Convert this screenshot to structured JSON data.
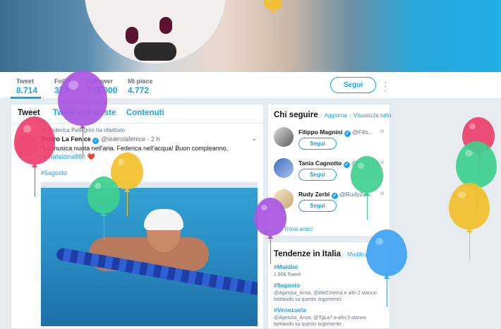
{
  "profile_nav": {
    "stats": [
      {
        "label": "Tweet",
        "value": "8.714",
        "active": true
      },
      {
        "label": "Follower",
        "value": "747.000",
        "active": false
      },
      {
        "label": "Mi piace",
        "value": "4.772",
        "active": false
      }
    ],
    "following_partial": {
      "label": "Follow",
      "value": "373"
    },
    "follow_button": "Segui"
  },
  "timeline": {
    "tabs": [
      "Tweet",
      "Tweet e risposte",
      "Contenuti"
    ],
    "retweet_text": "Federica Pellegrini ha ritwittato",
    "tweet": {
      "author": "Teatro La Fenice",
      "handle": "@teatrolafenice · 2 h",
      "text": "\"La musica nuota nell'aria. Federica nell'acqua! Buon compleanno,",
      "mention": "@mafaldina88!!",
      "emoji": "❤️",
      "hashtag": "#5agosto"
    }
  },
  "who_to_follow": {
    "title": "Chi seguire",
    "refresh": "Aggiorna",
    "view_all": "Visualizza tutto",
    "users": [
      {
        "name": "Filippo Magnini",
        "handle": "@Filo...",
        "button": "Segui"
      },
      {
        "name": "Tania Cagnotto",
        "handle": "@Tani...",
        "button": "Segui"
      },
      {
        "name": "Rudy Zerbi",
        "handle": "@RudyZe...",
        "button": "Segui"
      }
    ],
    "find_friends": "Trova amici"
  },
  "trends": {
    "title": "Tendenze in Italia",
    "edit": "Modifica",
    "items": [
      {
        "name": "#Maldini",
        "meta": "1.906 Tweet"
      },
      {
        "name": "#5agosto",
        "meta": "@Agenzia_Ansa, @WeCinema e altri 2 stanno twittando su questo argomento"
      },
      {
        "name": "#Venezuela",
        "meta": "@Agenzia_Ansa, @TgLa7 e altri 5 stanno twittando su questo argomento"
      }
    ]
  },
  "colors": {
    "accent": "#1da1f2",
    "balloon_purple": "#a855e0",
    "balloon_pink": "#ee3f6d",
    "balloon_yellow": "#f2c02c",
    "balloon_green": "#3ed08e",
    "balloon_blue": "#3ea4f5"
  }
}
